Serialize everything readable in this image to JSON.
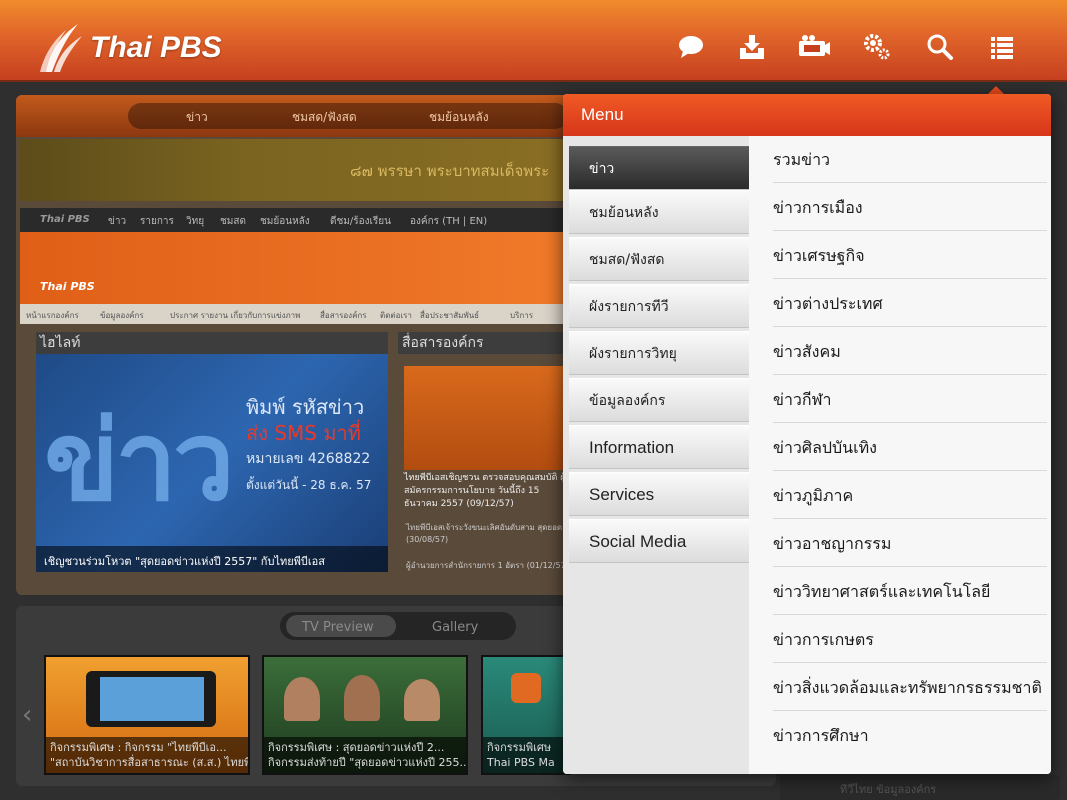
{
  "app": {
    "logo_text": "Thai PBS",
    "colors": {
      "brand_orange": "#e0642a",
      "menu_red": "#e94a1e",
      "active_item": "#2e2e2e"
    }
  },
  "toolbar": {
    "icons": [
      "chat-bubble-icon",
      "download-icon",
      "live-video-icon",
      "settings-icon",
      "search-icon",
      "list-menu-icon"
    ]
  },
  "background": {
    "site_tabs": [
      "ข่าว",
      "ชมสด/ฟังสด",
      "ชมย้อนหลัง"
    ],
    "banner_text": "๘๗ พรรษา พระบาทสมเด็จพระ",
    "site_nav": [
      "Thai PBS",
      "ข่าว",
      "รายการ",
      "วิทยุ",
      "ชมสด",
      "ชมย้อนหลัง",
      "ดีชม/ร้องเรียน",
      "องค์กร (TH | EN)"
    ],
    "mini_logo": "Thai PBS",
    "sub_nav": [
      "หน้าแรกองค์กร",
      "ข้อมูลองค์กร",
      "ประกาศ รายงาน เกี่ยวกับการแข่งภาพ",
      "สื่อสารองค์กร",
      "ติดต่อเรา",
      "สื่อประชาสัมพันธ์",
      "บริการ"
    ],
    "highlight": {
      "heading": "ไฮไลท์",
      "big_text": "ข่าว",
      "side_lines": [
        "พิมพ์ รหัสข่าว",
        "ส่ง SMS มาที่",
        "หมายเลข 4268822",
        "ตั้งแต่วันนี้ - 28 ธ.ค. 57"
      ],
      "caption": "เชิญชวนร่วมโหวต \"สุดยอดข่าวแห่งปี 2557\" กับไทยพีบีเอส"
    },
    "org": {
      "heading": "สื่อสารองค์กร",
      "text": "ไทยพีบีเอสเชิญชวน ตรวจสอบคุณสมบัติ ผู้สมัครกรรมการนโยบาย วันนี้ถึง 15 ธันวาคม 2557 (09/12/57)",
      "bullets": [
        "ไทยพีบีเอสเจ้าระวังขนะเลิศอันดับสาม สุดยอด... (30/08/57)",
        "ผู้อำนวยการสำนักรายการ 1 อัตรา (01/12/57)"
      ]
    },
    "preview_tabs": [
      "TV Preview",
      "Gallery"
    ],
    "thumbnails": [
      {
        "line1": "กิจกรรมพิเศษ : กิจกรรม \"ไทยพีบีเอ...",
        "line2": "\"สถาบันวิชาการสื่อสาธารณะ (ส.ส.) ไทยพี..."
      },
      {
        "line1": "กิจกรรมพิเศษ : สุดยอดข่าวแห่งปี 2...",
        "line2": "กิจกรรมส่งท้ายปี \"สุดยอดข่าวแห่งปี 255..."
      },
      {
        "line1": "กิจกรรมพิเศษ",
        "line2": "Thai PBS Ma"
      }
    ],
    "bottom_strip": "ทีวีไทย ข้อมูลองค์กร"
  },
  "menu": {
    "title": "Menu",
    "categories": [
      {
        "label": "ข่าว",
        "active": true
      },
      {
        "label": "ชมย้อนหลัง"
      },
      {
        "label": "ชมสด/ฟังสด"
      },
      {
        "label": "ผังรายการทีวี"
      },
      {
        "label": "ผังรายการวิทยุ"
      },
      {
        "label": "ข้อมูลองค์กร"
      },
      {
        "label": "Information"
      },
      {
        "label": "Services"
      },
      {
        "label": "Social Media"
      }
    ],
    "subitems": [
      "รวมข่าว",
      "ข่าวการเมือง",
      "ข่าวเศรษฐกิจ",
      "ข่าวต่างประเทศ",
      "ข่าวสังคม",
      "ข่าวกีฬา",
      "ข่าวศิลปบันเทิง",
      "ข่าวภูมิภาค",
      "ข่าวอาชญากรรม",
      "ข่าววิทยาศาสตร์และเทคโนโลยี",
      "ข่าวการเกษตร",
      "ข่าวสิ่งแวดล้อมและทรัพยากรธรรมชาติ",
      "ข่าวการศึกษา"
    ]
  }
}
